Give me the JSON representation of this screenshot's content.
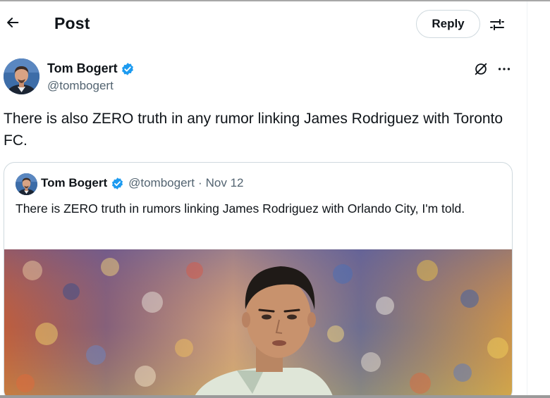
{
  "header": {
    "title": "Post",
    "reply_label": "Reply",
    "back_icon": "arrow-left-icon",
    "settings_icon": "sliders-icon"
  },
  "post": {
    "author_name": "Tom Bogert",
    "author_handle": "@tombogert",
    "verified": true,
    "text": "There is also ZERO truth in any rumor linking James Rodriguez with Toronto FC.",
    "actions_icons": [
      "grok-icon",
      "more-icon"
    ]
  },
  "quote": {
    "author_name": "Tom Bogert",
    "author_handle": "@tombogert",
    "separator": "·",
    "date": "Nov 12",
    "verified": true,
    "text": "There is ZERO truth in rumors linking James Rodriguez with Orlando City, I'm told.",
    "media": "photo"
  },
  "colors": {
    "text_primary": "#0f1419",
    "text_secondary": "#536471",
    "border": "#cfd9de",
    "verified_blue": "#1d9bf0"
  }
}
